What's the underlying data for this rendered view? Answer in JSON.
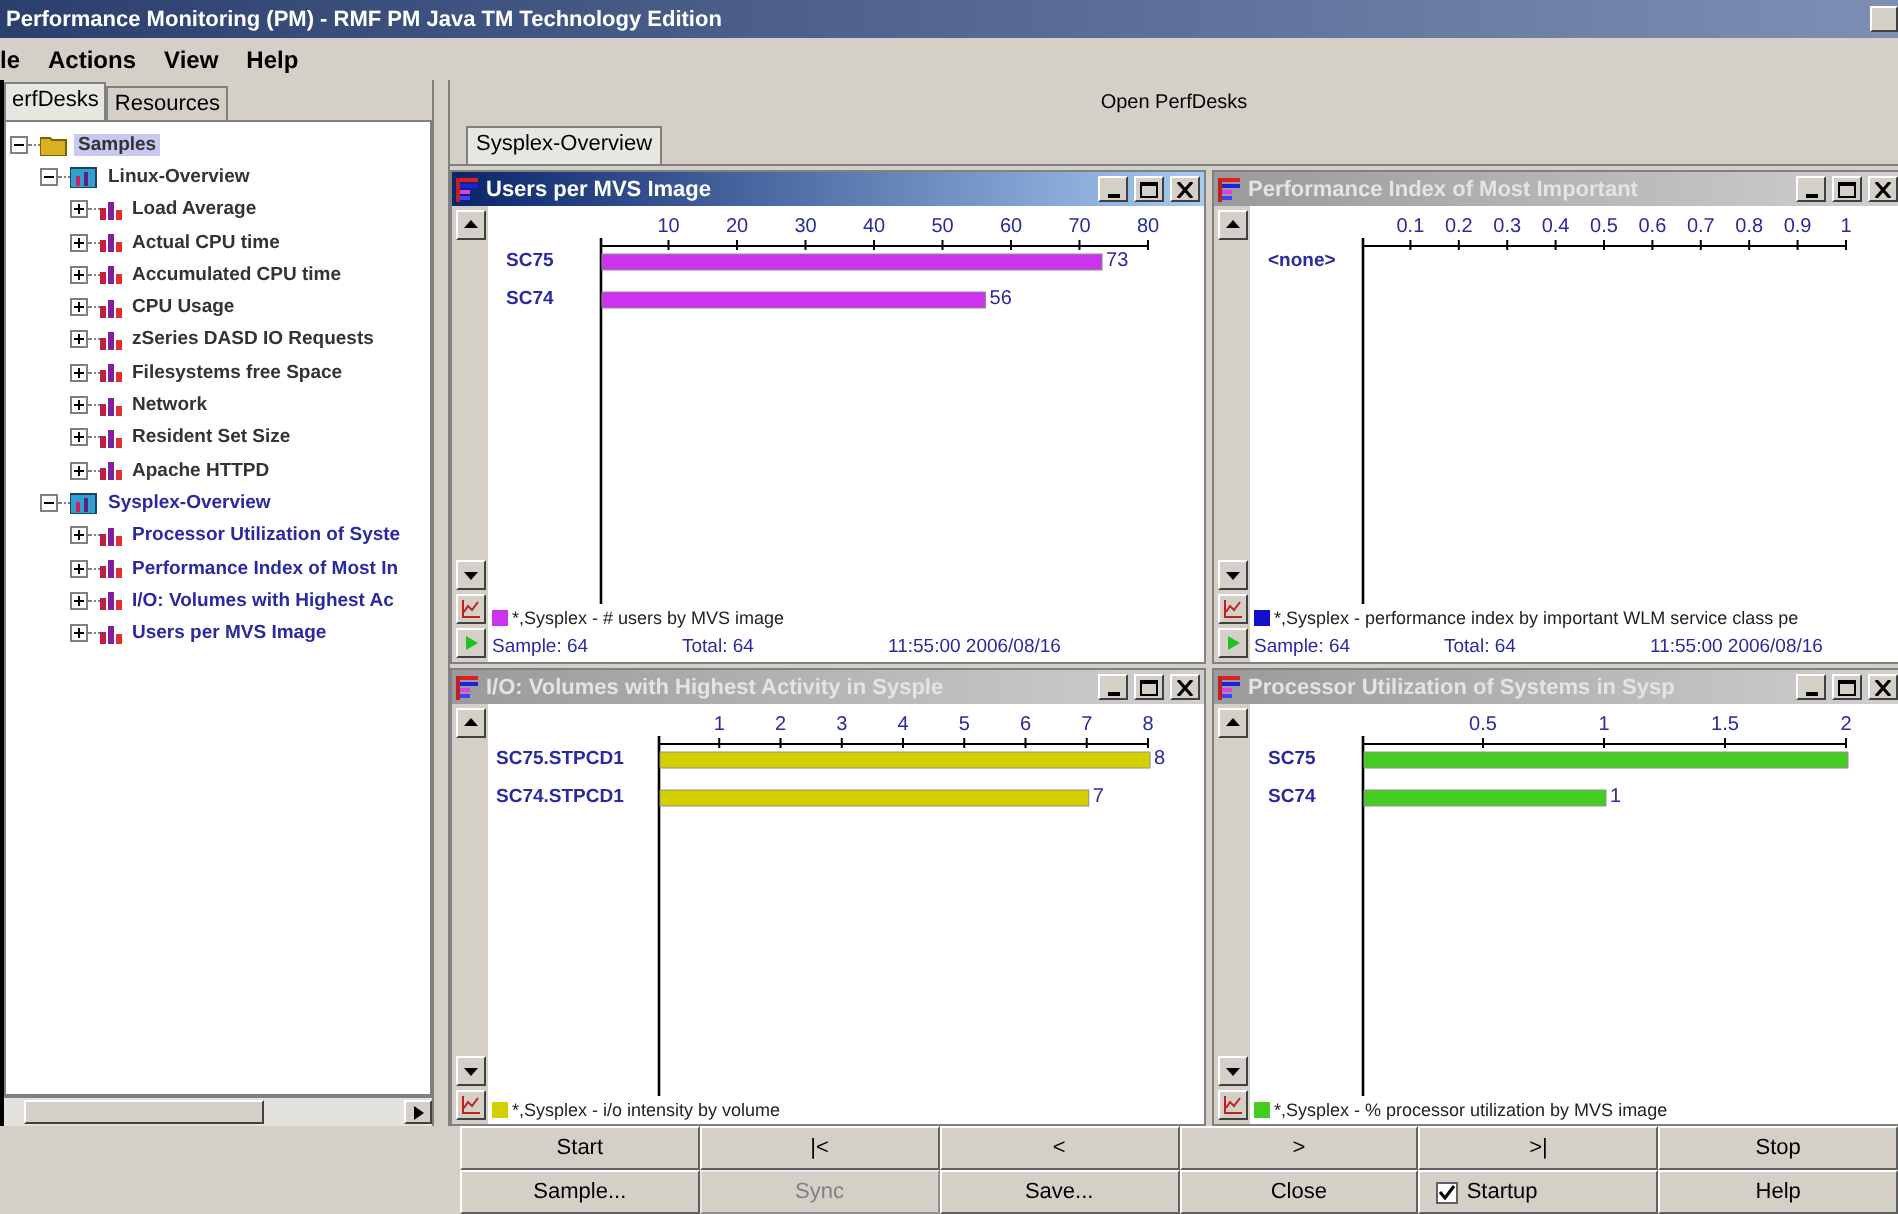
{
  "window": {
    "title": "Performance Monitoring (PM) - RMF PM Java TM Technology Edition"
  },
  "menu": [
    "le",
    "Actions",
    "View",
    "Help"
  ],
  "left_tabs": [
    {
      "label": "erfDesks",
      "selected": true
    },
    {
      "label": "Resources",
      "selected": false
    }
  ],
  "tree": [
    {
      "label": "Samples",
      "kind": "folder",
      "selected": true,
      "open": false,
      "expanded": true,
      "children": [
        {
          "label": "Linux-Overview",
          "kind": "desk",
          "selected": false,
          "open": false,
          "expanded": true,
          "children": [
            {
              "label": "Load Average",
              "kind": "report",
              "selected": false,
              "open": false,
              "expanded": false
            },
            {
              "label": "Actual CPU time",
              "kind": "report",
              "selected": false,
              "open": false,
              "expanded": false
            },
            {
              "label": "Accumulated CPU time",
              "kind": "report",
              "selected": false,
              "open": false,
              "expanded": false
            },
            {
              "label": "CPU Usage",
              "kind": "report",
              "selected": false,
              "open": false,
              "expanded": false
            },
            {
              "label": "zSeries DASD IO Requests",
              "kind": "report",
              "selected": false,
              "open": false,
              "expanded": false
            },
            {
              "label": "Filesystems free Space",
              "kind": "report",
              "selected": false,
              "open": false,
              "expanded": false
            },
            {
              "label": "Network",
              "kind": "report",
              "selected": false,
              "open": false,
              "expanded": false
            },
            {
              "label": "Resident Set Size",
              "kind": "report",
              "selected": false,
              "open": false,
              "expanded": false
            },
            {
              "label": "Apache HTTPD",
              "kind": "report",
              "selected": false,
              "open": false,
              "expanded": false
            }
          ]
        },
        {
          "label": "Sysplex-Overview",
          "kind": "desk",
          "selected": false,
          "open": true,
          "expanded": true,
          "children": [
            {
              "label": "Processor Utilization of Syste",
              "kind": "report",
              "selected": false,
              "open": true,
              "expanded": false
            },
            {
              "label": "Performance Index of Most In",
              "kind": "report",
              "selected": false,
              "open": true,
              "expanded": false
            },
            {
              "label": "I/O: Volumes with Highest Ac",
              "kind": "report",
              "selected": false,
              "open": true,
              "expanded": false
            },
            {
              "label": "Users per MVS Image",
              "kind": "report",
              "selected": false,
              "open": true,
              "expanded": false
            }
          ]
        }
      ]
    }
  ],
  "workspace": {
    "heading": "Open PerfDesks",
    "tabs": [
      {
        "label": "Sysplex-Overview",
        "selected": true
      }
    ]
  },
  "panes": [
    {
      "title": "Users per MVS Image",
      "active": true,
      "footer": {
        "sample": "Sample: 64",
        "total": "Total: 64",
        "time": "11:55:00  2006/08/16"
      },
      "chart_data": {
        "type": "bar",
        "orientation": "horizontal",
        "categories": [
          "SC75",
          "SC74"
        ],
        "series": [
          {
            "name": "*,Sysplex - # users by MVS image",
            "color": "#cc33ee",
            "values": [
              73,
              56
            ]
          }
        ],
        "xlim": [
          0,
          80
        ],
        "xticks": [
          10,
          20,
          30,
          40,
          50,
          60,
          70,
          80
        ],
        "data_labels": true
      }
    },
    {
      "title": "Performance Index of Most Important",
      "active": false,
      "footer": {
        "sample": "Sample: 64",
        "total": "Total: 64",
        "time": "11:55:00  2006/08/16"
      },
      "chart_data": {
        "type": "bar",
        "orientation": "horizontal",
        "categories": [
          "<none>"
        ],
        "series": [
          {
            "name": "*,Sysplex - performance index by important WLM service class pe",
            "color": "#1010cc",
            "values": [
              null
            ]
          }
        ],
        "xlim": [
          0,
          1
        ],
        "xticks": [
          0.1,
          0.2,
          0.3,
          0.4,
          0.5,
          0.6,
          0.7,
          0.8,
          0.9,
          1
        ]
      }
    },
    {
      "title": "I/O: Volumes with Highest Activity in Sysple",
      "active": false,
      "chart_data": {
        "type": "bar",
        "orientation": "horizontal",
        "categories": [
          "SC75.STPCD1",
          "SC74.STPCD1"
        ],
        "series": [
          {
            "name": "*,Sysplex - i/o intensity by volume",
            "color": "#d4d000",
            "values": [
              8,
              7
            ]
          }
        ],
        "xlim": [
          0,
          8
        ],
        "xticks": [
          1,
          2,
          3,
          4,
          5,
          6,
          7,
          8
        ],
        "data_labels": true
      }
    },
    {
      "title": "Processor Utilization of Systems in Sysp",
      "active": false,
      "chart_data": {
        "type": "bar",
        "orientation": "horizontal",
        "categories": [
          "SC75",
          "SC74"
        ],
        "series": [
          {
            "name": "*,Sysplex - % processor utilization by MVS image",
            "color": "#44cc22",
            "values": [
              2,
              1
            ]
          }
        ],
        "xlim": [
          0,
          2
        ],
        "xticks": [
          0.5,
          1,
          1.5,
          2
        ],
        "value_labels": [
          null,
          "1"
        ]
      }
    }
  ],
  "buttons": [
    {
      "label": "Start",
      "kind": "button",
      "disabled": false
    },
    {
      "label": "|<",
      "kind": "button",
      "disabled": false
    },
    {
      "label": "<",
      "kind": "button",
      "disabled": false
    },
    {
      "label": ">",
      "kind": "button",
      "disabled": false
    },
    {
      "label": ">|",
      "kind": "button",
      "disabled": false
    },
    {
      "label": "Stop",
      "kind": "button",
      "disabled": false
    },
    {
      "label": "Sample...",
      "kind": "button",
      "disabled": false
    },
    {
      "label": "Sync",
      "kind": "button",
      "disabled": true
    },
    {
      "label": "Save...",
      "kind": "button",
      "disabled": false
    },
    {
      "label": "Close",
      "kind": "button",
      "disabled": false
    },
    {
      "label": "Startup",
      "kind": "checkbox",
      "checked": true
    },
    {
      "label": "Help",
      "kind": "button",
      "disabled": false
    }
  ]
}
